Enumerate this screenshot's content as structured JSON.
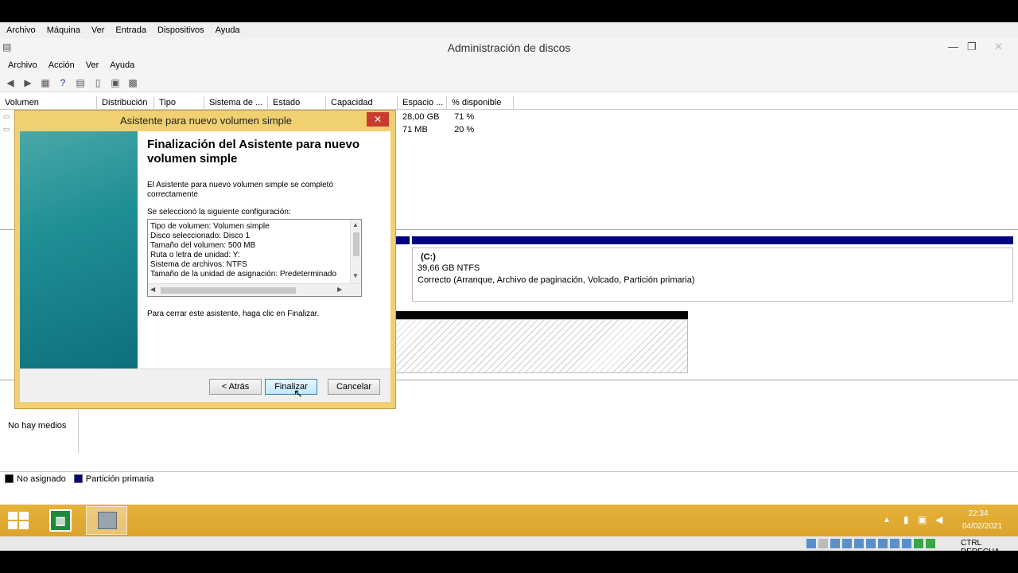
{
  "vbox_menu": [
    "Archivo",
    "Máquina",
    "Ver",
    "Entrada",
    "Dispositivos",
    "Ayuda"
  ],
  "window": {
    "title": "Administración de discos"
  },
  "app_menu": [
    "Archivo",
    "Acción",
    "Ver",
    "Ayuda"
  ],
  "columns": [
    "Volumen",
    "Distribución",
    "Tipo",
    "Sistema de ...",
    "Estado",
    "Capacidad",
    "Espacio ...",
    "% disponible"
  ],
  "volume_rows": [
    {
      "space": "28,00 GB",
      "pct": "71 %"
    },
    {
      "space": "71 MB",
      "pct": "20 %"
    }
  ],
  "disk_c": {
    "name": "(C:)",
    "size": "39,66 GB NTFS",
    "status": "Correcto (Arranque, Archivo de paginación, Volcado, Partición primaria)"
  },
  "cdrom": {
    "media": "No hay medios"
  },
  "legend": {
    "unassigned": "No asignado",
    "primary": "Partición primaria"
  },
  "colors": {
    "primary": "#000080",
    "unassigned": "#000000",
    "taskbar": "#e0aa30"
  },
  "dialog": {
    "title": "Asistente para nuevo volumen simple",
    "heading": "Finalización del Asistente para nuevo volumen simple",
    "completed": "El Asistente para nuevo volumen simple se completó correctamente",
    "config_label": "Se seleccionó la siguiente configuración:",
    "config_lines": [
      "Tipo de volumen: Volumen simple",
      "Disco seleccionado: Disco 1",
      "Tamaño del volumen: 500 MB",
      "Ruta o letra de unidad: Y:",
      "Sistema de archivos: NTFS",
      "Tamaño de la unidad de asignación: Predeterminado"
    ],
    "close_hint": "Para cerrar este asistente, haga clic en Finalizar.",
    "back": "< Atrás",
    "finish": "Finalizar",
    "cancel": "Cancelar"
  },
  "clock": {
    "time": "22:34",
    "date": "04/02/2021"
  },
  "vbox_status": {
    "host_key": "CTRL DERECHA"
  }
}
